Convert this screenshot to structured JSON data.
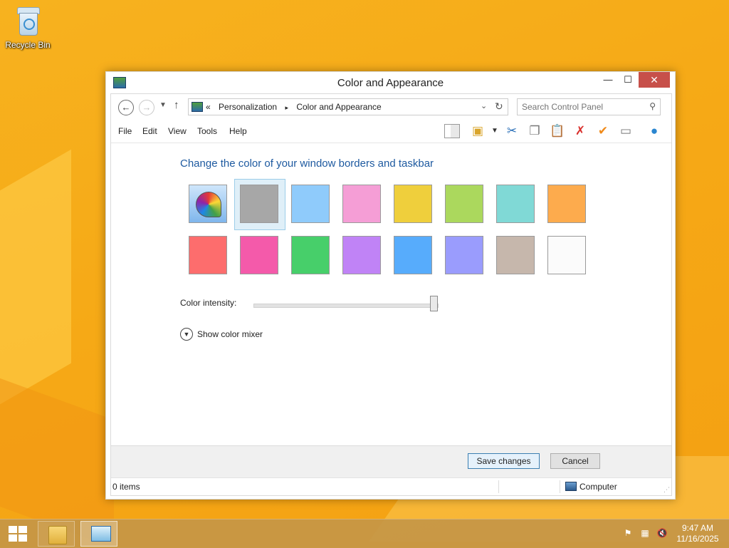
{
  "desktop": {
    "recycle_bin_label": "Recycle Bin"
  },
  "window": {
    "title": "Color and Appearance",
    "close_glyph": "✕",
    "minimize_glyph": "—",
    "maximize_glyph": "☐"
  },
  "address": {
    "chevron": "«",
    "crumbs": [
      "Personalization",
      "Color and Appearance"
    ],
    "separator": "▸",
    "search_placeholder": "Search Control Panel"
  },
  "menu": {
    "items": [
      "File",
      "Edit",
      "View",
      "Tools",
      "Help"
    ]
  },
  "content": {
    "heading": "Change the color of your window borders and taskbar",
    "swatch_colors": [
      [
        "automatic",
        "#a7a7a7",
        "#8fcbfb",
        "#f59ed6",
        "#efcf3c",
        "#abd85d",
        "#80d9d6",
        "#fdab4d"
      ],
      [
        "#fd6d6d",
        "#f45aaa",
        "#47cf6a",
        "#c083f6",
        "#57acfc",
        "#9a9cfd",
        "#c6b7ac",
        "#fbfbfb"
      ]
    ],
    "selected_swatch": "#a7a7a7",
    "intensity_label": "Color intensity:",
    "intensity_value": 1.0,
    "mixer_label": "Show color mixer"
  },
  "footer": {
    "save_label": "Save changes",
    "cancel_label": "Cancel"
  },
  "status": {
    "items_text": "0 items",
    "location_text": "Computer"
  },
  "taskbar": {
    "time": "9:47 AM",
    "date": "11/16/2025"
  },
  "colors": {
    "heading": "#1e5aa0",
    "close_button": "#c7504a",
    "wallpaper": "#f6a916"
  }
}
